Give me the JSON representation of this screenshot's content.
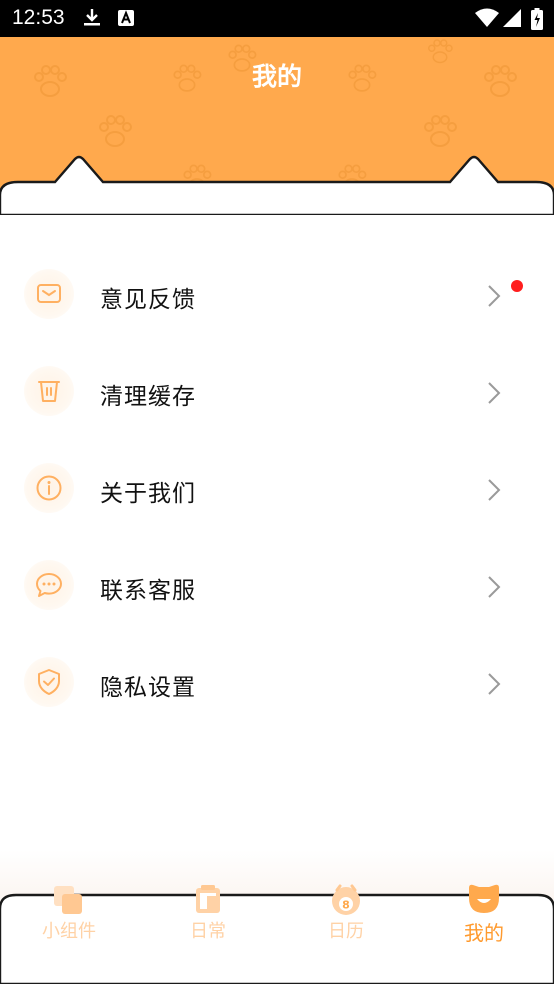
{
  "status_bar": {
    "time": "12:53",
    "icons": [
      "download-icon",
      "font-a-icon",
      "wifi-icon",
      "signal-icon",
      "battery-icon"
    ]
  },
  "header": {
    "title": "我的",
    "background": "#FFA94D"
  },
  "menu": {
    "items": [
      {
        "label": "意见反馈",
        "icon": "mail-icon",
        "has_dot": true
      },
      {
        "label": "清理缓存",
        "icon": "trash-icon",
        "has_dot": false
      },
      {
        "label": "关于我们",
        "icon": "info-icon",
        "has_dot": false
      },
      {
        "label": "联系客服",
        "icon": "chat-icon",
        "has_dot": false
      },
      {
        "label": "隐私设置",
        "icon": "shield-check-icon",
        "has_dot": false
      }
    ]
  },
  "bottom_nav": {
    "items": [
      {
        "label": "小组件",
        "icon": "widget-icon",
        "active": false
      },
      {
        "label": "日常",
        "icon": "daily-icon",
        "active": false
      },
      {
        "label": "日历",
        "icon": "calendar-icon",
        "badge": "8",
        "active": false
      },
      {
        "label": "我的",
        "icon": "profile-icon",
        "active": true
      }
    ]
  },
  "colors": {
    "accent": "#FFA94D",
    "icon_orange": "#FFB061",
    "active_tab": "#FF9A2E",
    "inactive_tab": "#FFD2A6",
    "notification_dot": "#FF1E1E"
  }
}
